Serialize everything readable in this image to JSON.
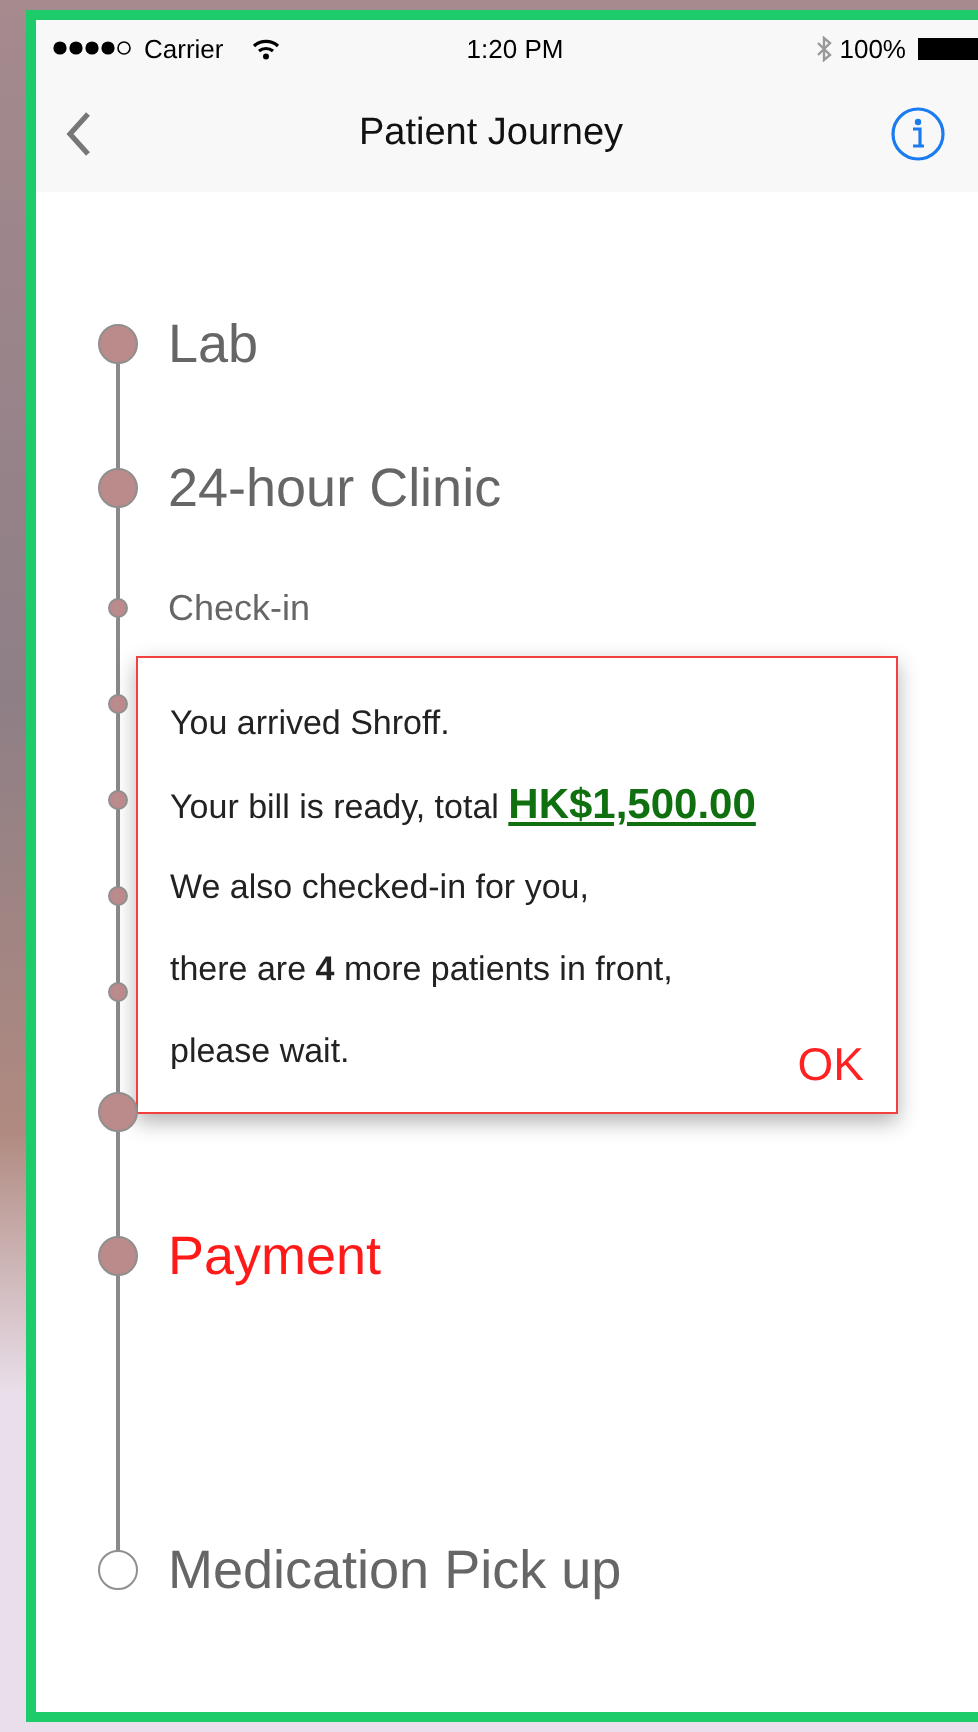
{
  "status_bar": {
    "carrier": "Carrier",
    "time": "1:20 PM",
    "battery": "100%"
  },
  "nav": {
    "title": "Patient Journey"
  },
  "timeline": [
    {
      "kind": "major",
      "label": "Lab",
      "done": true,
      "current": false
    },
    {
      "kind": "major",
      "label": "24-hour Clinic",
      "done": true,
      "current": false
    },
    {
      "kind": "minor",
      "label": "Check-in",
      "done": true,
      "current": false
    },
    {
      "kind": "minor",
      "done": true,
      "current": false
    },
    {
      "kind": "minor",
      "done": true,
      "current": false
    },
    {
      "kind": "minor",
      "done": true,
      "current": false
    },
    {
      "kind": "minor",
      "done": true,
      "current": false
    },
    {
      "kind": "major",
      "done": true,
      "current": false
    },
    {
      "kind": "major",
      "label": "Payment",
      "done": true,
      "current": true
    },
    {
      "kind": "major",
      "label": "Medication Pick up",
      "done": false,
      "current": false
    }
  ],
  "popup": {
    "lines": [
      {
        "text": "You arrived Shroff."
      },
      {
        "text": "Your bill is ready, total ",
        "amount": "HK$1,500.00"
      },
      {
        "text": "We also checked-in for you,"
      },
      {
        "text": "there are **4** more patients in front,"
      },
      {
        "text": "please wait."
      }
    ],
    "ok": "OK"
  }
}
